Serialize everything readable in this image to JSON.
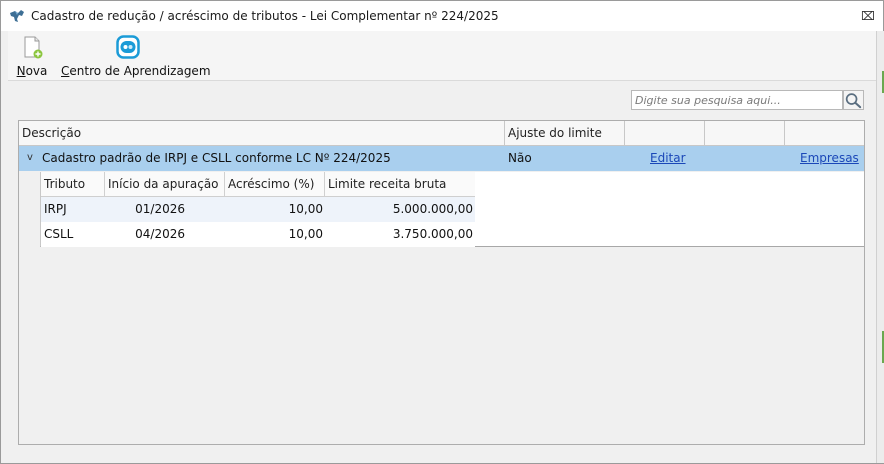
{
  "window": {
    "title": "Cadastro de redução / acréscimo de tributos - Lei Complementar nº 224/2025",
    "close_glyph": "⌧"
  },
  "toolbar": {
    "nova_mnemonic": "N",
    "nova_rest": "ova",
    "centro_mnemonic": "C",
    "centro_rest": "entro de Aprendizagem"
  },
  "search": {
    "placeholder": "Digite sua pesquisa aqui..."
  },
  "grid": {
    "headers": {
      "descricao": "Descrição",
      "ajuste": "Ajuste do limite",
      "col3": "",
      "col4": "",
      "col5": ""
    },
    "row": {
      "expand_glyph": "v",
      "descricao": "Cadastro padrão de IRPJ e CSLL conforme LC Nº 224/2025",
      "ajuste": "Não",
      "editar": "Editar",
      "empresas": "Empresas"
    },
    "detail": {
      "headers": {
        "tributo": "Tributo",
        "inicio": "Início da apuração",
        "acrescimo": "Acréscimo (%)",
        "limite": "Limite receita bruta"
      },
      "rows": [
        {
          "tributo": "IRPJ",
          "inicio": "01/2026",
          "acrescimo": "10,00",
          "limite": "5.000.000,00"
        },
        {
          "tributo": "CSLL",
          "inicio": "04/2026",
          "acrescimo": "10,00",
          "limite": "3.750.000,00"
        }
      ]
    }
  },
  "colors": {
    "selected_row": "#a9cfee",
    "link": "#1a47b8",
    "learning_icon": "#1b9bd7",
    "new_icon_badge": "#8cc63f"
  },
  "icons": [
    "app-icon",
    "close-icon",
    "new-document-icon",
    "learning-center-icon",
    "search-icon",
    "chevron-down-icon"
  ]
}
